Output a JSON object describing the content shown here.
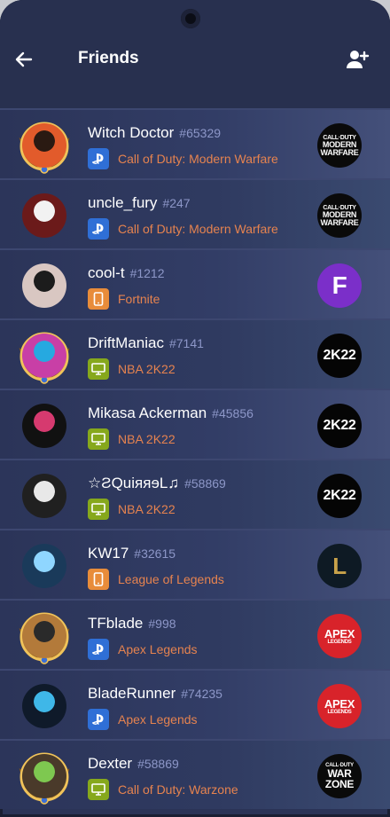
{
  "header": {
    "title": "Friends",
    "back_icon": "arrow-left-icon",
    "add_icon": "add-user-icon"
  },
  "colors": {
    "background": "#2b3457",
    "game_text": "#e6834f",
    "tag_text": "#8d97c8",
    "playstation": "#2f6fd6",
    "mobile": "#e88c3a",
    "pc": "#86a81c"
  },
  "friends": [
    {
      "name": "Witch Doctor",
      "tag": "#65329",
      "platform": "playstation",
      "game": "Call of Duty: Modern Warfare",
      "logo_lines": [
        "CALL·DUTY",
        "MODERN",
        "WARFARE"
      ]
    },
    {
      "name": "uncle_fury",
      "tag": "#247",
      "platform": "playstation",
      "game": "Call of Duty: Modern Warfare",
      "logo_lines": [
        "CALL·DUTY",
        "MODERN",
        "WARFARE"
      ]
    },
    {
      "name": "cool-t",
      "tag": "#1212",
      "platform": "mobile",
      "game": "Fortnite",
      "logo_lines": [
        "F"
      ]
    },
    {
      "name": "DriftManiac",
      "tag": "#7141",
      "platform": "pc",
      "game": "NBA 2K22",
      "logo_lines": [
        "2K22"
      ]
    },
    {
      "name": "Mikasa Ackerman",
      "tag": "#45856",
      "platform": "pc",
      "game": "NBA 2K22",
      "logo_lines": [
        "2K22"
      ]
    },
    {
      "name": "☆ƧQuiяяɘL♫",
      "tag": "#58869",
      "platform": "pc",
      "game": "NBA 2K22",
      "logo_lines": [
        "2K22"
      ]
    },
    {
      "name": "KW17",
      "tag": "#32615",
      "platform": "mobile",
      "game": "League of Legends",
      "logo_lines": [
        "L"
      ]
    },
    {
      "name": "TFblade",
      "tag": "#998",
      "platform": "playstation",
      "game": "Apex Legends",
      "logo_lines": [
        "APEX",
        "LEGENDS"
      ]
    },
    {
      "name": "BladeRunner",
      "tag": "#74235",
      "platform": "playstation",
      "game": "Apex Legends",
      "logo_lines": [
        "APEX",
        "LEGENDS"
      ]
    },
    {
      "name": "Dexter",
      "tag": "#58869",
      "platform": "pc",
      "game": "Call of Duty: Warzone",
      "logo_lines": [
        "CALL·DUTY",
        "WAR",
        "ZONE"
      ]
    }
  ]
}
